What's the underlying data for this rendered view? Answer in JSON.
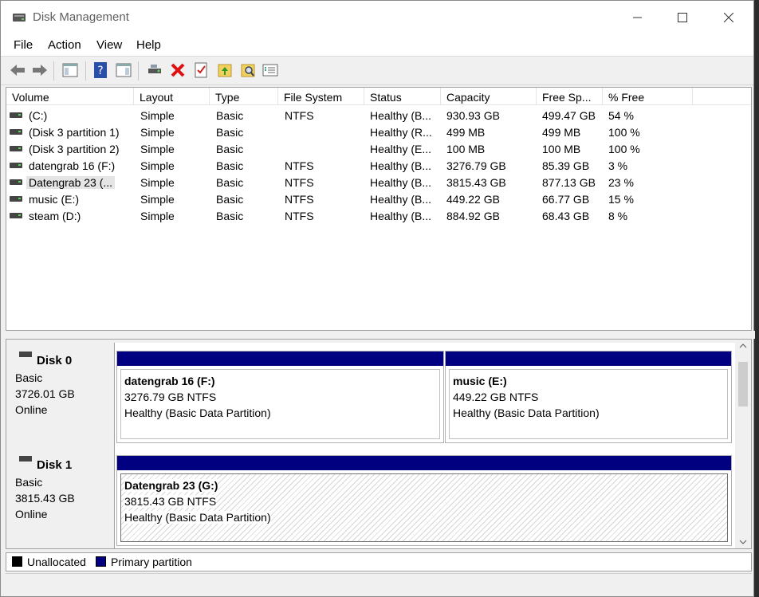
{
  "window": {
    "title": "Disk Management"
  },
  "menu": [
    "File",
    "Action",
    "View",
    "Help"
  ],
  "columns": [
    "Volume",
    "Layout",
    "Type",
    "File System",
    "Status",
    "Capacity",
    "Free Sp...",
    "% Free"
  ],
  "volumes": [
    {
      "volume": "(C:)",
      "layout": "Simple",
      "type": "Basic",
      "fs": "NTFS",
      "status": "Healthy (B...",
      "capacity": "930.93 GB",
      "free": "499.47 GB",
      "pct": "54 %"
    },
    {
      "volume": "(Disk 3 partition 1)",
      "layout": "Simple",
      "type": "Basic",
      "fs": "",
      "status": "Healthy (R...",
      "capacity": "499 MB",
      "free": "499 MB",
      "pct": "100 %"
    },
    {
      "volume": "(Disk 3 partition 2)",
      "layout": "Simple",
      "type": "Basic",
      "fs": "",
      "status": "Healthy (E...",
      "capacity": "100 MB",
      "free": "100 MB",
      "pct": "100 %"
    },
    {
      "volume": "datengrab 16 (F:)",
      "layout": "Simple",
      "type": "Basic",
      "fs": "NTFS",
      "status": "Healthy (B...",
      "capacity": "3276.79 GB",
      "free": "85.39 GB",
      "pct": "3 %"
    },
    {
      "volume": "Datengrab 23 (...",
      "layout": "Simple",
      "type": "Basic",
      "fs": "NTFS",
      "status": "Healthy (B...",
      "capacity": "3815.43 GB",
      "free": "877.13 GB",
      "pct": "23 %"
    },
    {
      "volume": "music (E:)",
      "layout": "Simple",
      "type": "Basic",
      "fs": "NTFS",
      "status": "Healthy (B...",
      "capacity": "449.22 GB",
      "free": "66.77 GB",
      "pct": "15 %"
    },
    {
      "volume": "steam (D:)",
      "layout": "Simple",
      "type": "Basic",
      "fs": "NTFS",
      "status": "Healthy (B...",
      "capacity": "884.92 GB",
      "free": "68.43 GB",
      "pct": "8 %"
    }
  ],
  "disks": [
    {
      "name": "Disk 0",
      "type": "Basic",
      "size": "3726.01 GB",
      "state": "Online",
      "partitions": [
        {
          "title": "datengrab 16  (F:)",
          "size": "3276.79 GB NTFS",
          "status": "Healthy (Basic Data Partition)"
        },
        {
          "title": "music  (E:)",
          "size": "449.22 GB NTFS",
          "status": "Healthy (Basic Data Partition)"
        }
      ]
    },
    {
      "name": "Disk 1",
      "type": "Basic",
      "size": "3815.43 GB",
      "state": "Online",
      "partitions": [
        {
          "title": "Datengrab 23  (G:)",
          "size": "3815.43 GB NTFS",
          "status": "Healthy (Basic Data Partition)"
        }
      ]
    }
  ],
  "legend": [
    {
      "label": "Unallocated",
      "color": "#000000"
    },
    {
      "label": "Primary partition",
      "color": "#000080"
    }
  ],
  "selected_row": 4
}
